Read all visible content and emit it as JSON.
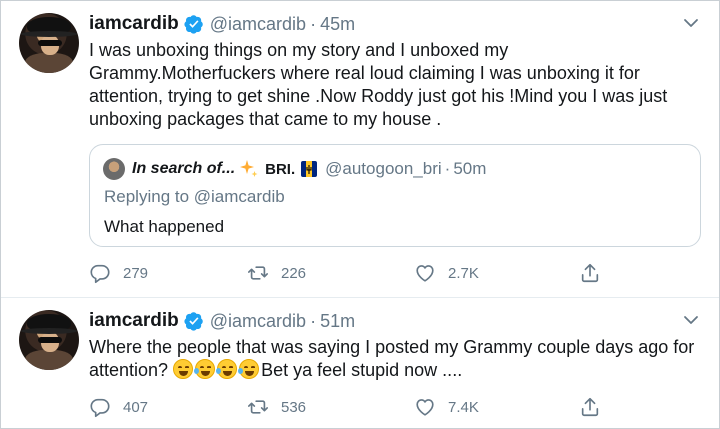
{
  "colors": {
    "accent": "#1da1f2",
    "muted": "#657786",
    "text": "#14171a",
    "border": "#ccd6dd"
  },
  "tweets": [
    {
      "name": "iamcardib",
      "handle": "@iamcardib",
      "separator": "·",
      "time": "45m",
      "text": "I was unboxing things on my story and I unboxed my Grammy.Motherfuckers where real loud claiming I was unboxing it for attention, trying to get shine .Now Roddy just got his !Mind you I was just unboxing packages that came to my house .",
      "quote": {
        "name": "In search of...",
        "name2": "BRI.",
        "handle": "@autogoon_bri",
        "separator": "·",
        "time": "50m",
        "replying": "Replying to @iamcardib",
        "text": "What happened"
      },
      "stats": {
        "replies": "279",
        "retweets": "226",
        "likes": "2.7K"
      }
    },
    {
      "name": "iamcardib",
      "handle": "@iamcardib",
      "separator": "·",
      "time": "51m",
      "text_before": "Where the people that was saying I posted my Grammy couple days ago for attention? ",
      "text_after": "Bet ya feel stupid now ....",
      "stats": {
        "replies": "407",
        "retweets": "536",
        "likes": "7.4K"
      }
    }
  ],
  "icons": [
    "verified-icon",
    "chevron-down-icon",
    "reply-icon",
    "retweet-icon",
    "like-icon",
    "share-icon",
    "sparkles-icon",
    "barbados-flag-icon",
    "crying-laughing-emoji-icon",
    "weary-face-emoji-icon"
  ]
}
